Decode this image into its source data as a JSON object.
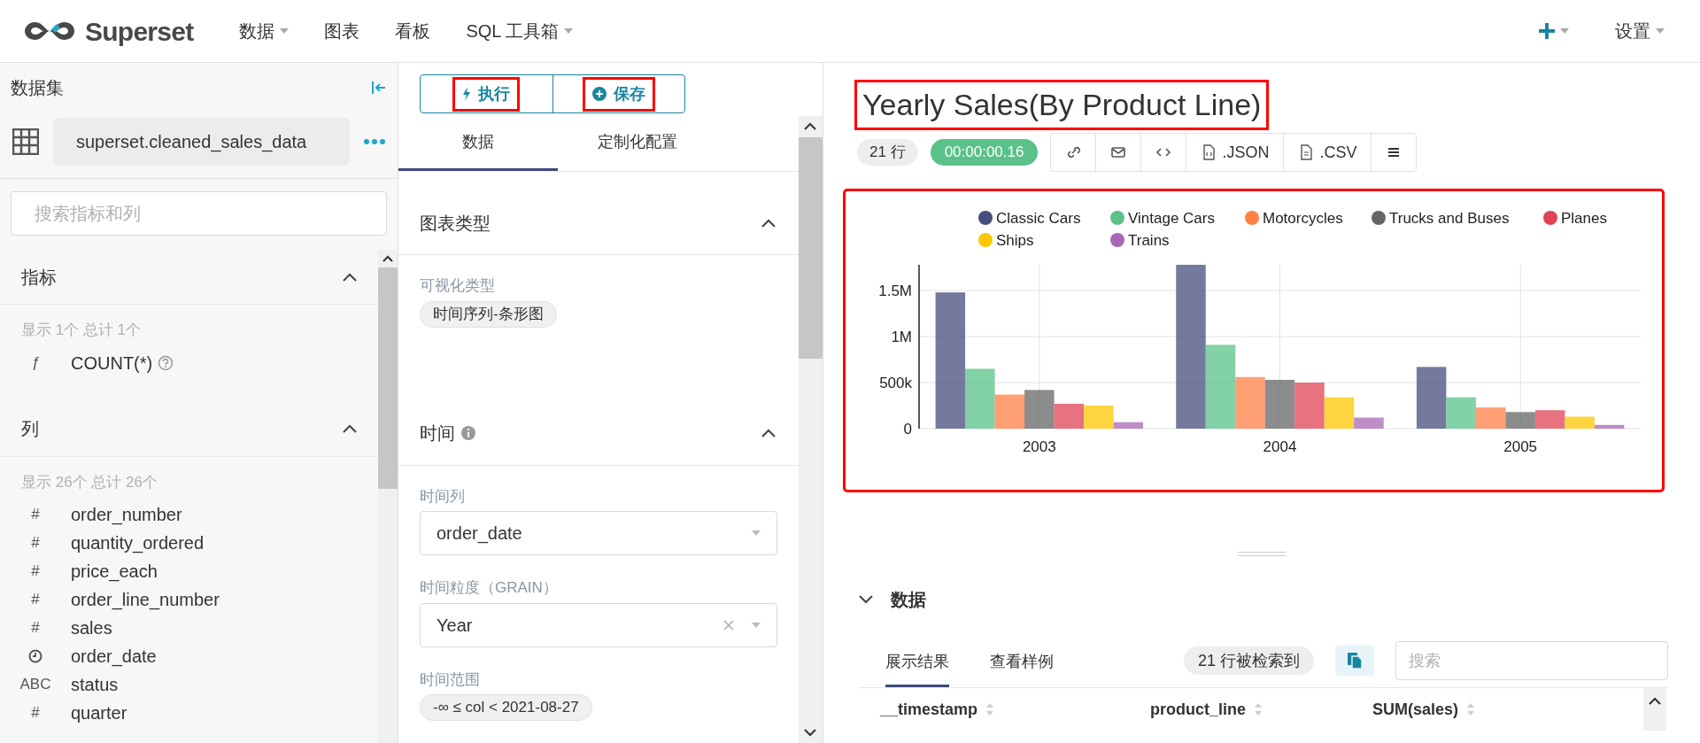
{
  "navbar": {
    "logo": "Superset",
    "menus": [
      {
        "label": "数据",
        "dropdown": true
      },
      {
        "label": "图表",
        "dropdown": false
      },
      {
        "label": "看板",
        "dropdown": false
      },
      {
        "label": "SQL 工具箱",
        "dropdown": true
      }
    ],
    "right_menus": [
      {
        "kind": "plus",
        "dropdown": true
      },
      {
        "kind": "text",
        "label": "设置",
        "dropdown": true
      }
    ]
  },
  "dataset_panel": {
    "title": "数据集",
    "dataset_name": "superset.cleaned_sales_data",
    "search": {
      "placeholder": "搜索指标和列"
    },
    "sections": [
      {
        "title": "指标",
        "expanded": true,
        "summary": "显示 1个 总计 1个",
        "items": [
          {
            "kind": "metric",
            "type_label": "ƒ",
            "name": "COUNT(*)",
            "help": true
          }
        ]
      },
      {
        "title": "列",
        "expanded": true,
        "summary": "显示 26个 总计 26个",
        "items": [
          {
            "kind": "column",
            "type_label": "#",
            "name": "order_number"
          },
          {
            "kind": "column",
            "type_label": "#",
            "name": "quantity_ordered"
          },
          {
            "kind": "column",
            "type_label": "#",
            "name": "price_each"
          },
          {
            "kind": "column",
            "type_label": "#",
            "name": "order_line_number"
          },
          {
            "kind": "column",
            "type_label": "#",
            "name": "sales"
          },
          {
            "kind": "temporal",
            "name": "order_date"
          },
          {
            "kind": "column",
            "type_label": "ABC",
            "name": "status"
          },
          {
            "kind": "column",
            "type_label": "#",
            "name": "quarter"
          }
        ]
      }
    ]
  },
  "control_panel": {
    "buttons": [
      {
        "kind": "run",
        "label": "执行",
        "highlighted": true
      },
      {
        "kind": "save",
        "label": "保存",
        "highlighted": true
      }
    ],
    "tabs": [
      {
        "label": "数据",
        "selected": true
      },
      {
        "label": "定制化配置",
        "selected": false
      }
    ],
    "sections": [
      {
        "title": "图表类型",
        "info": false,
        "expanded": true,
        "controls": [
          {
            "kind": "pill",
            "label": "可视化类型",
            "value": "时间序列-条形图"
          }
        ]
      },
      {
        "title": "时间",
        "info": true,
        "expanded": true,
        "controls": [
          {
            "kind": "select",
            "label": "时间列",
            "value": "order_date",
            "clearable": false
          },
          {
            "kind": "select",
            "label": "时间粒度（GRAIN）",
            "value": "Year",
            "clearable": true
          },
          {
            "kind": "pill",
            "label": "时间范围",
            "value": "-∞ ≤ col < 2021-08-27"
          }
        ]
      }
    ]
  },
  "chart_panel": {
    "title": "Yearly Sales(By Product Line)",
    "title_highlighted": true,
    "row_count": "21 行",
    "query_time": "00:00:00.16",
    "actions": [
      {
        "kind": "link"
      },
      {
        "kind": "mail"
      },
      {
        "kind": "code"
      },
      {
        "kind": "json",
        "label": ".JSON"
      },
      {
        "kind": "csv",
        "label": ".CSV"
      },
      {
        "kind": "menu"
      }
    ],
    "chart_highlighted": true,
    "chart_data": {
      "type": "bar",
      "stacked": false,
      "grid": true,
      "legend": "top",
      "categories": [
        "2003",
        "2004",
        "2005"
      ],
      "ylim": [
        0,
        1780000
      ],
      "yticks": [
        {
          "value": 0,
          "label": "0"
        },
        {
          "value": 500000,
          "label": "500k"
        },
        {
          "value": 1000000,
          "label": "1M"
        },
        {
          "value": 1500000,
          "label": "1.5M"
        }
      ],
      "series": [
        {
          "name": "Classic Cars",
          "color": "#454e7c",
          "values": [
            1480000,
            1780000,
            670000
          ]
        },
        {
          "name": "Vintage Cars",
          "color": "#5ac189",
          "values": [
            650000,
            910000,
            340000
          ]
        },
        {
          "name": "Motorcycles",
          "color": "#ff7f44",
          "values": [
            370000,
            560000,
            230000
          ]
        },
        {
          "name": "Trucks and Buses",
          "color": "#666666",
          "values": [
            420000,
            530000,
            180000
          ]
        },
        {
          "name": "Planes",
          "color": "#e04355",
          "values": [
            270000,
            500000,
            200000
          ]
        },
        {
          "name": "Ships",
          "color": "#fcc700",
          "values": [
            250000,
            340000,
            130000
          ]
        },
        {
          "name": "Trains",
          "color": "#a868b7",
          "values": [
            70000,
            120000,
            40000
          ]
        }
      ]
    }
  },
  "data_pane": {
    "title": "数据",
    "expanded": true,
    "tabs": [
      {
        "label": "展示结果",
        "selected": true
      },
      {
        "label": "查看样例",
        "selected": false
      }
    ],
    "result_count": "21 行被检索到",
    "search": {
      "placeholder": "搜索"
    },
    "columns": [
      "__timestamp",
      "product_line",
      "SUM(sales)"
    ]
  }
}
